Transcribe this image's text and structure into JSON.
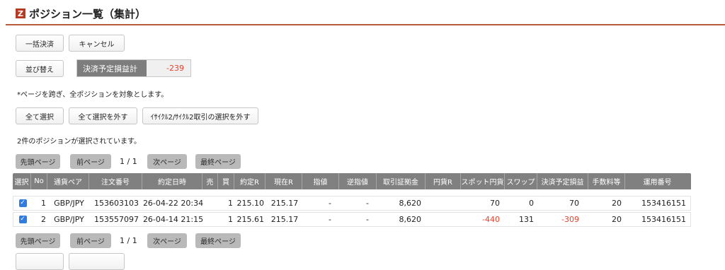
{
  "header": {
    "logo_text": "Z",
    "title": "ポジション一覧（集計）"
  },
  "actions": {
    "bulk_settle": "一括決済",
    "cancel": "キャンセル",
    "sort": "並び替え"
  },
  "total": {
    "label": "決済予定損益計",
    "value": "-239",
    "value_color": "#e0432f"
  },
  "note": "*ページを跨ぎ、全ポジションを対象とします。",
  "select": {
    "select_all": "全て選択",
    "deselect_all": "全て選択を外す",
    "deselect_icycle": "ｲｻｲｸﾙ2/ｻｲｸﾙ2取引の選択を外す"
  },
  "selected_msg": "2件のポジションが選択されています。",
  "pagination": {
    "first": "先頭ページ",
    "prev": "前ページ",
    "indicator": "1 / 1",
    "next": "次ページ",
    "last": "最終ページ"
  },
  "table": {
    "headers": [
      "選択",
      "No",
      "通貨ペア",
      "注文番号",
      "約定日時",
      "売",
      "買",
      "約定R",
      "現在R",
      "指値",
      "逆指値",
      "取引証拠金",
      "円貨R",
      "スポット円貨",
      "スワップ",
      "決済予定損益",
      "手数料等",
      "運用番号"
    ],
    "rows": [
      {
        "checked": true,
        "no": "1",
        "pair": "GBP/JPY",
        "order": "153603103",
        "datetime": "26-04-22 20:34",
        "sell": "",
        "buy": "1",
        "rate": "215.10",
        "current": "215.17",
        "limit": "-",
        "stop": "-",
        "margin": "8,620",
        "yen_rate": "",
        "spot": "70",
        "swap": "0",
        "pl": "70",
        "fee": "20",
        "op": "153416151"
      },
      {
        "checked": true,
        "no": "2",
        "pair": "GBP/JPY",
        "order": "153557097",
        "datetime": "26-04-14 21:15",
        "sell": "",
        "buy": "1",
        "rate": "215.61",
        "current": "215.17",
        "limit": "-",
        "stop": "-",
        "margin": "8,620",
        "yen_rate": "",
        "spot": "-440",
        "swap": "131",
        "pl": "-309",
        "fee": "20",
        "op": "153416151"
      }
    ]
  }
}
